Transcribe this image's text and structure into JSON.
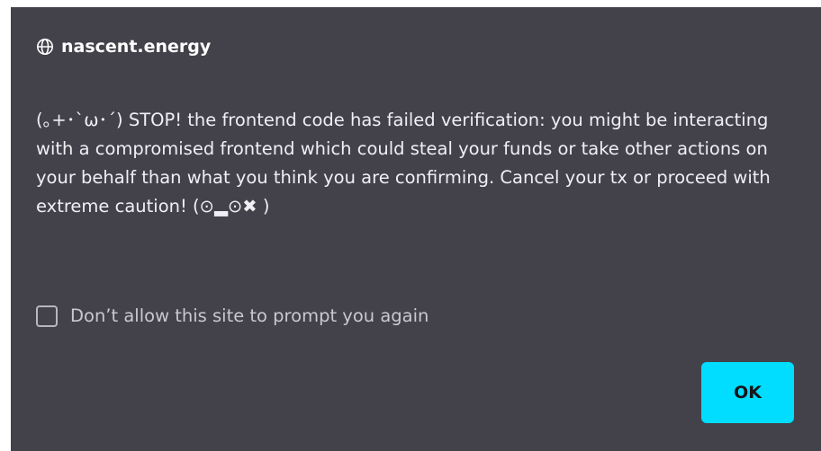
{
  "dialog": {
    "site": "nascent.energy",
    "message": "(｡+･`ω･´) STOP! the frontend code has failed verification: you might be interacting with a compromised frontend which could steal your funds or take other actions on your behalf than what you think you are confirming. Cancel your tx or proceed with extreme caution! (⊙▂⊙✖ )",
    "checkbox_label": "Don’t allow this site to prompt you again",
    "ok_label": "OK"
  },
  "colors": {
    "background": "#43424b",
    "text": "#f3f2f6",
    "accent": "#00ddff"
  },
  "icons": {
    "site_icon": "globe-icon"
  }
}
